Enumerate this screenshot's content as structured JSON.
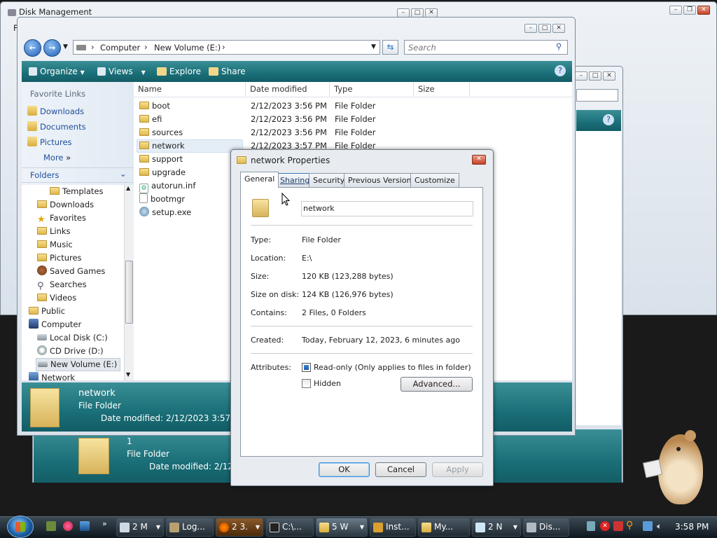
{
  "disk_mgmt": {
    "title": "Disk Management",
    "menu_letter": "F"
  },
  "explorer": {
    "address": [
      "Computer",
      "New Volume (E:)"
    ],
    "search_placeholder": "Search",
    "toolbar": {
      "organize": "Organize",
      "views": "Views",
      "explore": "Explore",
      "share": "Share"
    },
    "favorite_links_heading": "Favorite Links",
    "favorite_links": [
      "Downloads",
      "Documents",
      "Pictures"
    ],
    "more": "More",
    "folders_heading": "Folders",
    "folders": [
      "Templates",
      "Downloads",
      "Favorites",
      "Links",
      "Music",
      "Pictures",
      "Saved Games",
      "Searches",
      "Videos",
      "Public",
      "Computer",
      "Local Disk (C:)",
      "CD Drive (D:)",
      "New Volume (E:)",
      "Network"
    ],
    "columns": [
      "Name",
      "Date modified",
      "Type",
      "Size"
    ],
    "files": [
      {
        "name": "boot",
        "date": "2/12/2023 3:56 PM",
        "type": "File Folder"
      },
      {
        "name": "efi",
        "date": "2/12/2023 3:56 PM",
        "type": "File Folder"
      },
      {
        "name": "sources",
        "date": "2/12/2023 3:56 PM",
        "type": "File Folder"
      },
      {
        "name": "network",
        "date": "2/12/2023 3:57 PM",
        "type": "File Folder"
      },
      {
        "name": "support",
        "date": "",
        "type": ""
      },
      {
        "name": "upgrade",
        "date": "",
        "type": ""
      },
      {
        "name": "autorun.inf",
        "date": "",
        "type": ""
      },
      {
        "name": "bootmgr",
        "date": "",
        "type": ""
      },
      {
        "name": "setup.exe",
        "date": "",
        "type": ""
      }
    ],
    "details": {
      "name": "network",
      "type": "File Folder",
      "modified": "Date modified: 2/12/2023 3:57 PM"
    }
  },
  "back_window": {
    "details": {
      "name": "1",
      "type": "File Folder",
      "modified": "Date modified: 2/12/2"
    }
  },
  "dialog": {
    "title": "network Properties",
    "tabs": [
      "General",
      "Sharing",
      "Security",
      "Previous Versions",
      "Customize"
    ],
    "name_value": "network",
    "props": {
      "type_label": "Type:",
      "type": "File Folder",
      "location_label": "Location:",
      "location": "E:\\",
      "size_label": "Size:",
      "size": "120 KB (123,288 bytes)",
      "size_disk_label": "Size on disk:",
      "size_disk": "124 KB (126,976 bytes)",
      "contains_label": "Contains:",
      "contains": "2 Files, 0 Folders",
      "created_label": "Created:",
      "created": "Today, February 12, 2023, 6 minutes ago",
      "attributes_label": "Attributes:"
    },
    "readonly_label": "Read-only (Only applies to files in folder)",
    "hidden_label": "Hidden",
    "advanced": "Advanced...",
    "ok": "OK",
    "cancel": "Cancel",
    "apply": "Apply"
  },
  "taskbar": {
    "items": [
      "2 M",
      "Log...",
      "2 3.",
      "C:\\...",
      "5 W",
      "Inst...",
      "My...",
      "2 N",
      "Dis..."
    ],
    "clock": "3:58 PM"
  },
  "colors": {
    "accent_teal": "#1a6f78",
    "selection": "#d5e8f7"
  }
}
